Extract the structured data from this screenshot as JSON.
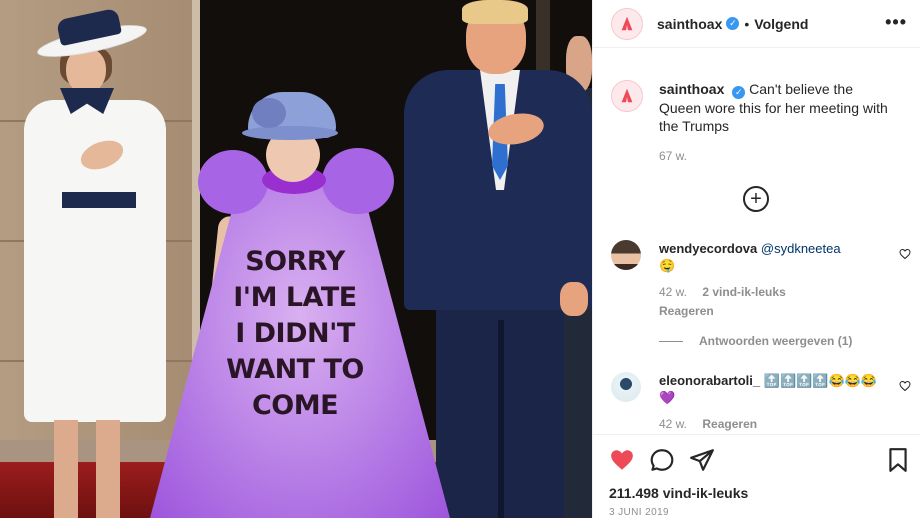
{
  "post": {
    "image_text": [
      "SORRY",
      "I'M LATE",
      "I DIDN'T",
      "WANT TO",
      "COME"
    ]
  },
  "header": {
    "username": "sainthoax",
    "separator": "•",
    "follow_label": "Volgend",
    "more_label": "•••"
  },
  "caption": {
    "username": "sainthoax",
    "text": "Can't believe the Queen wore this for her meeting with the Trumps",
    "time": "67 w."
  },
  "load_more": "+",
  "comments": [
    {
      "username": "wendyecordova",
      "mention": "@sydkneetea",
      "emoji": "🤤",
      "time": "42 w.",
      "likes": "2 vind-ik-leuks",
      "reply": "Reageren"
    },
    {
      "username": "eleonorabartoli_",
      "text": "🔝🔝🔝🔝😂😂😂💜",
      "time": "42 w.",
      "reply": "Reageren"
    }
  ],
  "view_replies": "Antwoorden weergeven (1)",
  "footer": {
    "likes": "211.498 vind-ik-leuks",
    "date": "3 JUNI 2019"
  },
  "colors": {
    "like_red": "#ed4956",
    "verified_blue": "#3897f0",
    "muted": "#8e8e8e"
  },
  "icons": [
    "heart-icon",
    "comment-icon",
    "share-icon",
    "bookmark-icon",
    "more-icon",
    "verified-icon",
    "add-comment-icon"
  ]
}
